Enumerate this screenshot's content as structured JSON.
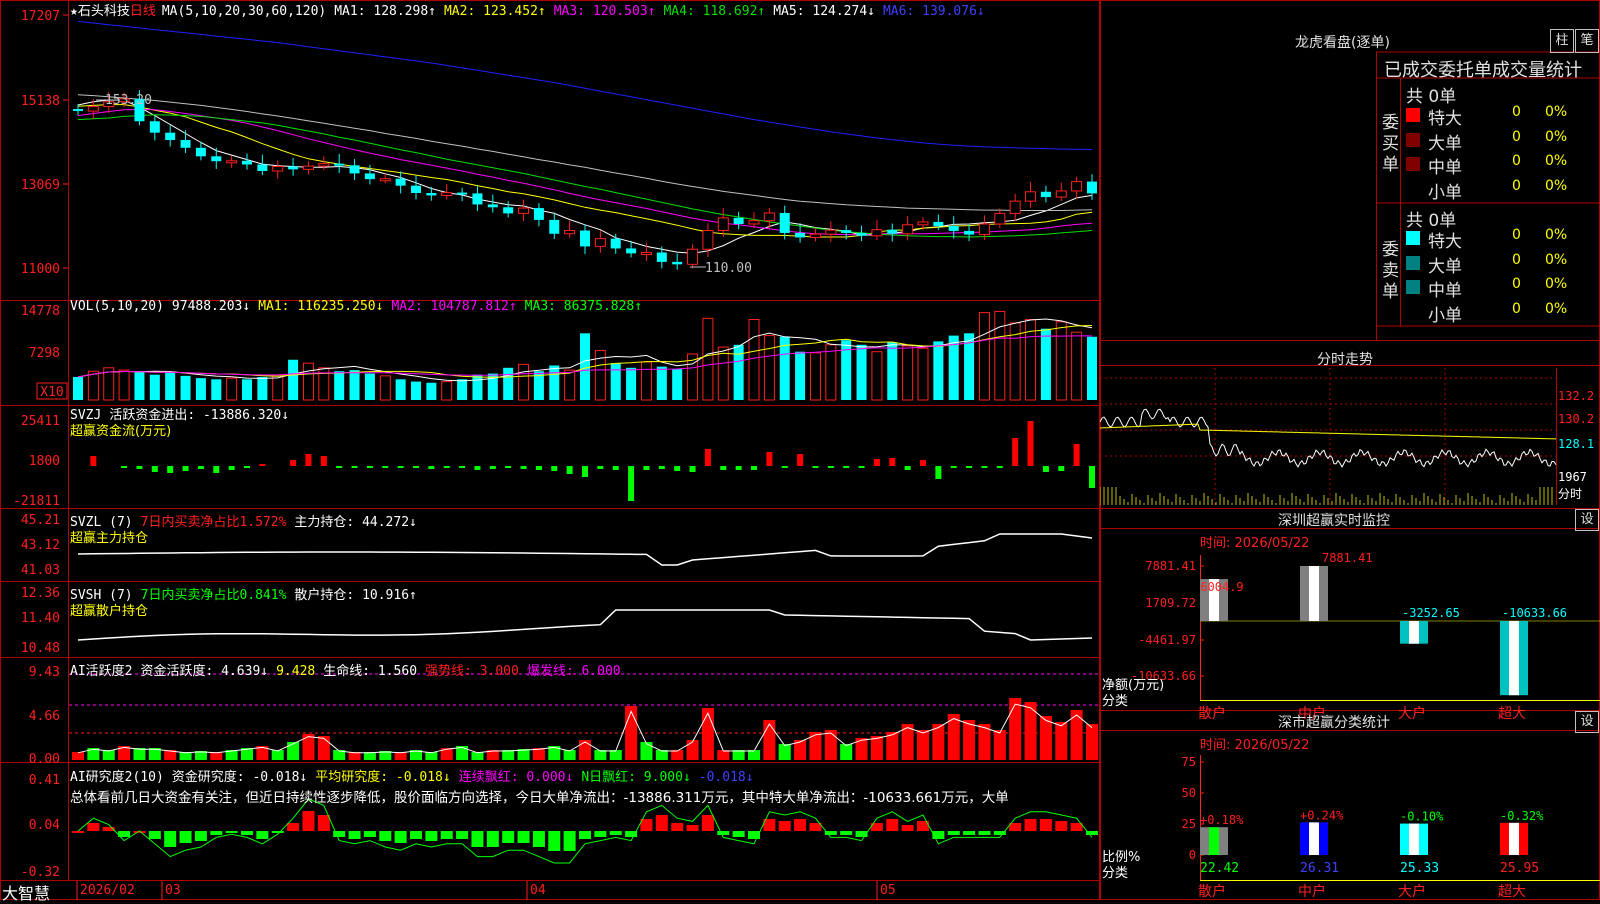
{
  "app": {
    "brand": "大智慧"
  },
  "stock": {
    "star": "★",
    "name": "石头科技",
    "period": "日线",
    "high_mark": "153.20",
    "low_mark": "110.00"
  },
  "colors": {
    "up": "#ff2020",
    "down": "#00ffff",
    "grid": "#b00000",
    "ma1": "#ffffff",
    "ma2": "#ffff00",
    "ma3": "#ff00ff",
    "ma4": "#00e000",
    "ma5": "#c0c0c0",
    "ma6": "#2020ff"
  },
  "header_main": [
    {
      "text": "MA(5,10,20,30,60,120)",
      "color": "#ffffff"
    },
    {
      "text": "MA1: 128.298↑",
      "color": "#ffffff"
    },
    {
      "text": "MA2: 123.452↑",
      "color": "#ffff00"
    },
    {
      "text": "MA3: 120.503↑",
      "color": "#ff00ff"
    },
    {
      "text": "MA4: 118.692↑",
      "color": "#00e000"
    },
    {
      "text": "MA5: 124.274↓",
      "color": "#ffffff"
    },
    {
      "text": "MA6: 139.076↓",
      "color": "#4040ff"
    }
  ],
  "header_vol": [
    {
      "text": "VOL(5,10,20)",
      "color": "#ffffff"
    },
    {
      "text": "97488.203↓",
      "color": "#ffffff"
    },
    {
      "text": "MA1: 116235.250↓",
      "color": "#ffff00"
    },
    {
      "text": "MA2: 104787.812↑",
      "color": "#ff00ff"
    },
    {
      "text": "MA3: 86375.828↑",
      "color": "#00ff00"
    }
  ],
  "header_svzj": [
    {
      "text": "SVZJ",
      "color": "#ffffff"
    },
    {
      "text": "活跃资金进出: -13886.320↓",
      "color": "#ffffff"
    }
  ],
  "sub_svzj": "超赢资金流(万元)",
  "header_svzl": [
    {
      "text": "SVZL (7)",
      "color": "#ffffff"
    },
    {
      "text": "7日内买卖净占比1.572%",
      "color": "#ff2020"
    },
    {
      "text": "主力持仓: 44.272↓",
      "color": "#ffffff"
    }
  ],
  "sub_svzl": "超赢主力持仓",
  "header_svsh": [
    {
      "text": "SVSH (7)",
      "color": "#ffffff"
    },
    {
      "text": "7日内买卖净占比0.841%",
      "color": "#00ff00"
    },
    {
      "text": "散户持仓: 10.916↑",
      "color": "#ffffff"
    }
  ],
  "sub_svsh": "超赢散户持仓",
  "header_ai2": [
    {
      "text": "AI活跃度2",
      "color": "#ffffff"
    },
    {
      "text": "资金活跃度: 4.639↓",
      "color": "#ffffff"
    },
    {
      "text": "9.428",
      "color": "#ffff00"
    },
    {
      "text": "生命线: 1.560",
      "color": "#ffffff"
    },
    {
      "text": "强势线: 3.000",
      "color": "#ff2020"
    },
    {
      "text": "爆发线: 6.000",
      "color": "#ff00ff"
    }
  ],
  "header_ai_research": [
    {
      "text": "AI研究度2(10)",
      "color": "#ffffff"
    },
    {
      "text": "资金研究度: -0.018↓",
      "color": "#ffffff"
    },
    {
      "text": "平均研究度: -0.018↓",
      "color": "#ffff00"
    },
    {
      "text": "连续飘红: 0.000↓",
      "color": "#ff00ff"
    },
    {
      "text": "N日飘红: 9.000↓",
      "color": "#00ff00"
    },
    {
      "text": "-0.018↓",
      "color": "#4040ff"
    }
  ],
  "summary_text": "总体看前几日大资金有关注，但近日持续性逐步降低，股价面临方向选择，今日大单净流出：-13886.311万元，其中特大单净流出：-10633.661万元，大单",
  "axis": {
    "price": [
      "17207",
      "15138",
      "13069",
      "11000"
    ],
    "vol": [
      "14778",
      "7298",
      "X10"
    ],
    "svzj": [
      "25411",
      "1800",
      "-21811"
    ],
    "svzl": [
      "45.21",
      "43.12",
      "41.03"
    ],
    "svsh": [
      "12.36",
      "11.40",
      "10.48"
    ],
    "ai2": [
      "9.43",
      "4.66",
      "0.00"
    ],
    "air": [
      "0.41",
      "0.04",
      "-0.32"
    ]
  },
  "dates": [
    "2026/02",
    "03",
    "04",
    "05"
  ],
  "longhu": {
    "title": "龙虎看盘(逐单)",
    "btn_bar": "柱",
    "btn_pen": "笔",
    "tabs": "已成交委托单成交量统计",
    "buy_title": "委买单",
    "sell_title": "委卖单",
    "buy_total": "共 0单",
    "sell_total": "共 0单",
    "rows": [
      {
        "label": "特大",
        "count": "0",
        "pct": "0%"
      },
      {
        "label": "大单",
        "count": "0",
        "pct": "0%"
      },
      {
        "label": "中单",
        "count": "0",
        "pct": "0%"
      },
      {
        "label": "小单",
        "count": "0",
        "pct": "0%"
      }
    ]
  },
  "intraday": {
    "title": "分时走势",
    "price_ticks": [
      "132.2",
      "130.2",
      "128.1"
    ],
    "vol_tick": "1967",
    "vol_label": "分时"
  },
  "monitor": {
    "title": "深圳超赢实时监控",
    "set": "设",
    "time": "时间: 2026/05/22",
    "y_ticks": [
      "7881.41",
      "1709.72",
      "-4461.97",
      "-10633.66"
    ],
    "ylabel": "净额(万元)",
    "xlabel": "分类",
    "categories": [
      "散户",
      "中户",
      "大户",
      "超大"
    ],
    "value_labels": [
      "6004.9",
      "7881.41",
      "-3252.65",
      "-10633.66"
    ]
  },
  "classify": {
    "title": "深市超赢分类统计",
    "set": "设",
    "time": "时间: 2026/05/22",
    "y_ticks": [
      "75",
      "50",
      "25",
      "0"
    ],
    "ylabel": "比例%",
    "xlabel": "分类",
    "categories": [
      "散户",
      "中户",
      "大户",
      "超大"
    ],
    "change_labels": [
      "+0.18%",
      "+0.24%",
      "-0.10%",
      "-0.32%"
    ],
    "value_labels": [
      "22.42",
      "26.31",
      "25.33",
      "25.95"
    ]
  },
  "chart_data": [
    {
      "type": "bar",
      "name": "深圳超赢实时监控",
      "categories": [
        "散户",
        "中户",
        "大户",
        "超大"
      ],
      "values": [
        6004.9,
        7881.41,
        -3252.65,
        -10633.66
      ],
      "ylabel": "净额(万元)",
      "xlabel": "分类",
      "ylim": [
        -10633.66,
        7881.41
      ]
    },
    {
      "type": "bar",
      "name": "深市超赢分类统计",
      "categories": [
        "散户",
        "中户",
        "大户",
        "超大"
      ],
      "values": [
        22.42,
        26.31,
        25.33,
        25.95
      ],
      "changes": [
        "+0.18%",
        "+0.24%",
        "-0.10%",
        "-0.32%"
      ],
      "ylabel": "比例%",
      "xlabel": "分类",
      "ylim": [
        0,
        75
      ]
    },
    {
      "type": "line",
      "name": "candlestick",
      "ylim": [
        11000,
        17207
      ],
      "x": [
        "2026/02",
        "03",
        "04",
        "05"
      ],
      "series": [
        {
          "name": "close",
          "values": [
            148.5,
            149.6,
            150.8,
            151.5,
            146,
            143.2,
            141.4,
            139.5,
            137.4,
            136.2,
            136.3,
            135.4,
            133.8,
            134.9,
            134.2,
            135,
            135.6,
            135.2,
            133.2,
            131.8,
            131.9,
            130.2,
            128.4,
            127.8,
            128.5,
            128.3,
            125.6,
            124.9,
            123.4,
            124.7,
            121.8,
            118.4,
            119.2,
            115.3,
            117.2,
            114.8,
            113.6,
            113.8,
            111.5,
            110.9,
            114.6,
            119.2,
            122.3,
            120.8,
            121.6,
            123.5,
            118.6,
            117.5,
            118.3,
            119.3,
            118.6,
            117.9,
            119.4,
            118.4,
            120.6,
            121.3,
            120.3,
            119.1,
            118.2,
            120.8,
            123.4,
            126.4,
            128.7,
            127.4,
            128.9,
            131.2,
            128.3
          ]
        },
        {
          "name": "MA1",
          "values": [
            150,
            150.8,
            151.2,
            151.2,
            149.4,
            147.4,
            145.2,
            143,
            140.8,
            138.8,
            137.7,
            136.6,
            135.5,
            135.1,
            134.9,
            134.7,
            134.7,
            134.9,
            134.6,
            134.1,
            133.1,
            132.2,
            130.9,
            129.5,
            128.5,
            127.9,
            126.9,
            126.2,
            125.5,
            125.2,
            124.2,
            123.4,
            121.9,
            120.6,
            119.4,
            117.4,
            116.4,
            115.3,
            114.6,
            113.9,
            113.6,
            114.2,
            115.5,
            117.3,
            118.7,
            120.2,
            121.3,
            120.7,
            119.9,
            119.5,
            119,
            118.1,
            118.1,
            118.6,
            118.9,
            119.8,
            120.1,
            120.7,
            120.8,
            121.1,
            121.3,
            121.7,
            122.9,
            124,
            125.6,
            127.2,
            127.8
          ]
        },
        {
          "name": "MA2",
          "values": [
            149.7,
            149.9,
            150.1,
            150.1,
            149.5,
            148.7,
            148,
            147.1,
            145.8,
            144.5,
            143.4,
            142,
            140.5,
            139.2,
            137.9,
            136.8,
            136.1,
            135.5,
            134.9,
            134.4,
            133.9,
            133.4,
            132.8,
            132.2,
            131.7,
            131,
            130.2,
            129.5,
            128.7,
            128.2,
            127.5,
            126.7,
            125.8,
            124.9,
            124.2,
            123.6,
            122.8,
            122.1,
            121.3,
            120.5,
            119.6,
            118.8,
            118.4,
            118.2,
            118,
            118,
            118,
            117.8,
            117.6,
            117.6,
            117.6,
            118,
            118.8,
            119.3,
            119.3,
            119.8,
            120,
            120.3,
            120.4,
            120.7,
            120.8,
            120.9,
            121,
            121.3,
            122,
            123.2,
            123.7
          ]
        },
        {
          "name": "MA3",
          "values": [
            147.4,
            147.9,
            148.4,
            148.8,
            148.9,
            148.8,
            148.4,
            147.9,
            147.4,
            146.8,
            146.2,
            145.5,
            144.6,
            143.7,
            142.7,
            141.7,
            140.8,
            139.9,
            139,
            138.2,
            137.4,
            136.6,
            135.9,
            135.2,
            134.5,
            133.8,
            133,
            132.3,
            131.5,
            130.8,
            130,
            129.2,
            128.3,
            127.5,
            126.7,
            126,
            125.3,
            124.6,
            123.8,
            123,
            122.2,
            121.6,
            121,
            120.6,
            120.1,
            119.6,
            119.1,
            118.7,
            118.4,
            118.3,
            118.2,
            118.2,
            118.4,
            118.4,
            118.4,
            118.4,
            118.5,
            118.6,
            118.7,
            118.8,
            119,
            119.2,
            119.4,
            119.8,
            120.3,
            120.7,
            121
          ]
        },
        {
          "name": "MA4",
          "values": [
            146.4,
            146.6,
            146.8,
            147.2,
            147.4,
            147.6,
            147.5,
            147.4,
            147.2,
            146.8,
            146.4,
            146,
            145.6,
            145,
            144.3,
            143.6,
            142.9,
            142.1,
            141.4,
            140.6,
            139.8,
            139,
            138.3,
            137.5,
            136.7,
            136,
            135.3,
            134.6,
            133.9,
            133.2,
            132.4,
            131.6,
            130.8,
            130,
            129.3,
            128.5,
            127.7,
            126.9,
            126.1,
            125.3,
            124.5,
            123.8,
            123.1,
            122.5,
            121.9,
            121.3,
            120.8,
            120.3,
            119.8,
            119.3,
            118.9,
            118.6,
            118.3,
            118.1,
            117.9,
            117.8,
            117.7,
            117.7,
            117.6,
            117.7,
            117.8,
            117.9,
            118.1,
            118.3,
            118.6,
            118.9,
            119.2
          ]
        },
        {
          "name": "MA5",
          "values": [
            152.5,
            152.3,
            152,
            151.7,
            151.4,
            151.1,
            150.7,
            150.3,
            149.9,
            149.4,
            148.9,
            148.4,
            147.8,
            147.3,
            146.7,
            146.1,
            145.5,
            144.9,
            144.3,
            143.7,
            143,
            142.4,
            141.8,
            141.1,
            140.5,
            139.9,
            139.2,
            138.6,
            137.9,
            137.3,
            136.6,
            136,
            135.3,
            134.7,
            134,
            133.3,
            132.7,
            132,
            131.3,
            130.6,
            130,
            129.4,
            128.8,
            128.3,
            127.8,
            127.3,
            126.8,
            126.4,
            126.1,
            125.8,
            125.5,
            125.3,
            125.1,
            124.9,
            124.7,
            124.6,
            124.5,
            124.4,
            124.3,
            124.2,
            124.2,
            124.1,
            124.1,
            124.1,
            124.1,
            124.2,
            124.3
          ]
        },
        {
          "name": "MA6",
          "values": [
            170.5,
            170.1,
            169.7,
            169.3,
            168.9,
            168.5,
            168.1,
            167.7,
            167.3,
            166.9,
            166.5,
            166.1,
            165.7,
            165.3,
            164.8,
            164.3,
            163.8,
            163.3,
            162.8,
            162.3,
            161.8,
            161.3,
            160.8,
            160.3,
            159.7,
            159.1,
            158.5,
            157.9,
            157.3,
            156.7,
            156.1,
            155.5,
            154.8,
            154.1,
            153.4,
            152.7,
            152,
            151.3,
            150.6,
            149.9,
            149.2,
            148.5,
            147.8,
            147.1,
            146.4,
            145.8,
            145.2,
            144.6,
            144,
            143.4,
            142.9,
            142.4,
            141.9,
            141.5,
            141.1,
            140.7,
            140.4,
            140.1,
            139.9,
            139.7,
            139.6,
            139.5,
            139.4,
            139.3,
            139.2,
            139.1,
            139.1
          ]
        }
      ]
    }
  ]
}
